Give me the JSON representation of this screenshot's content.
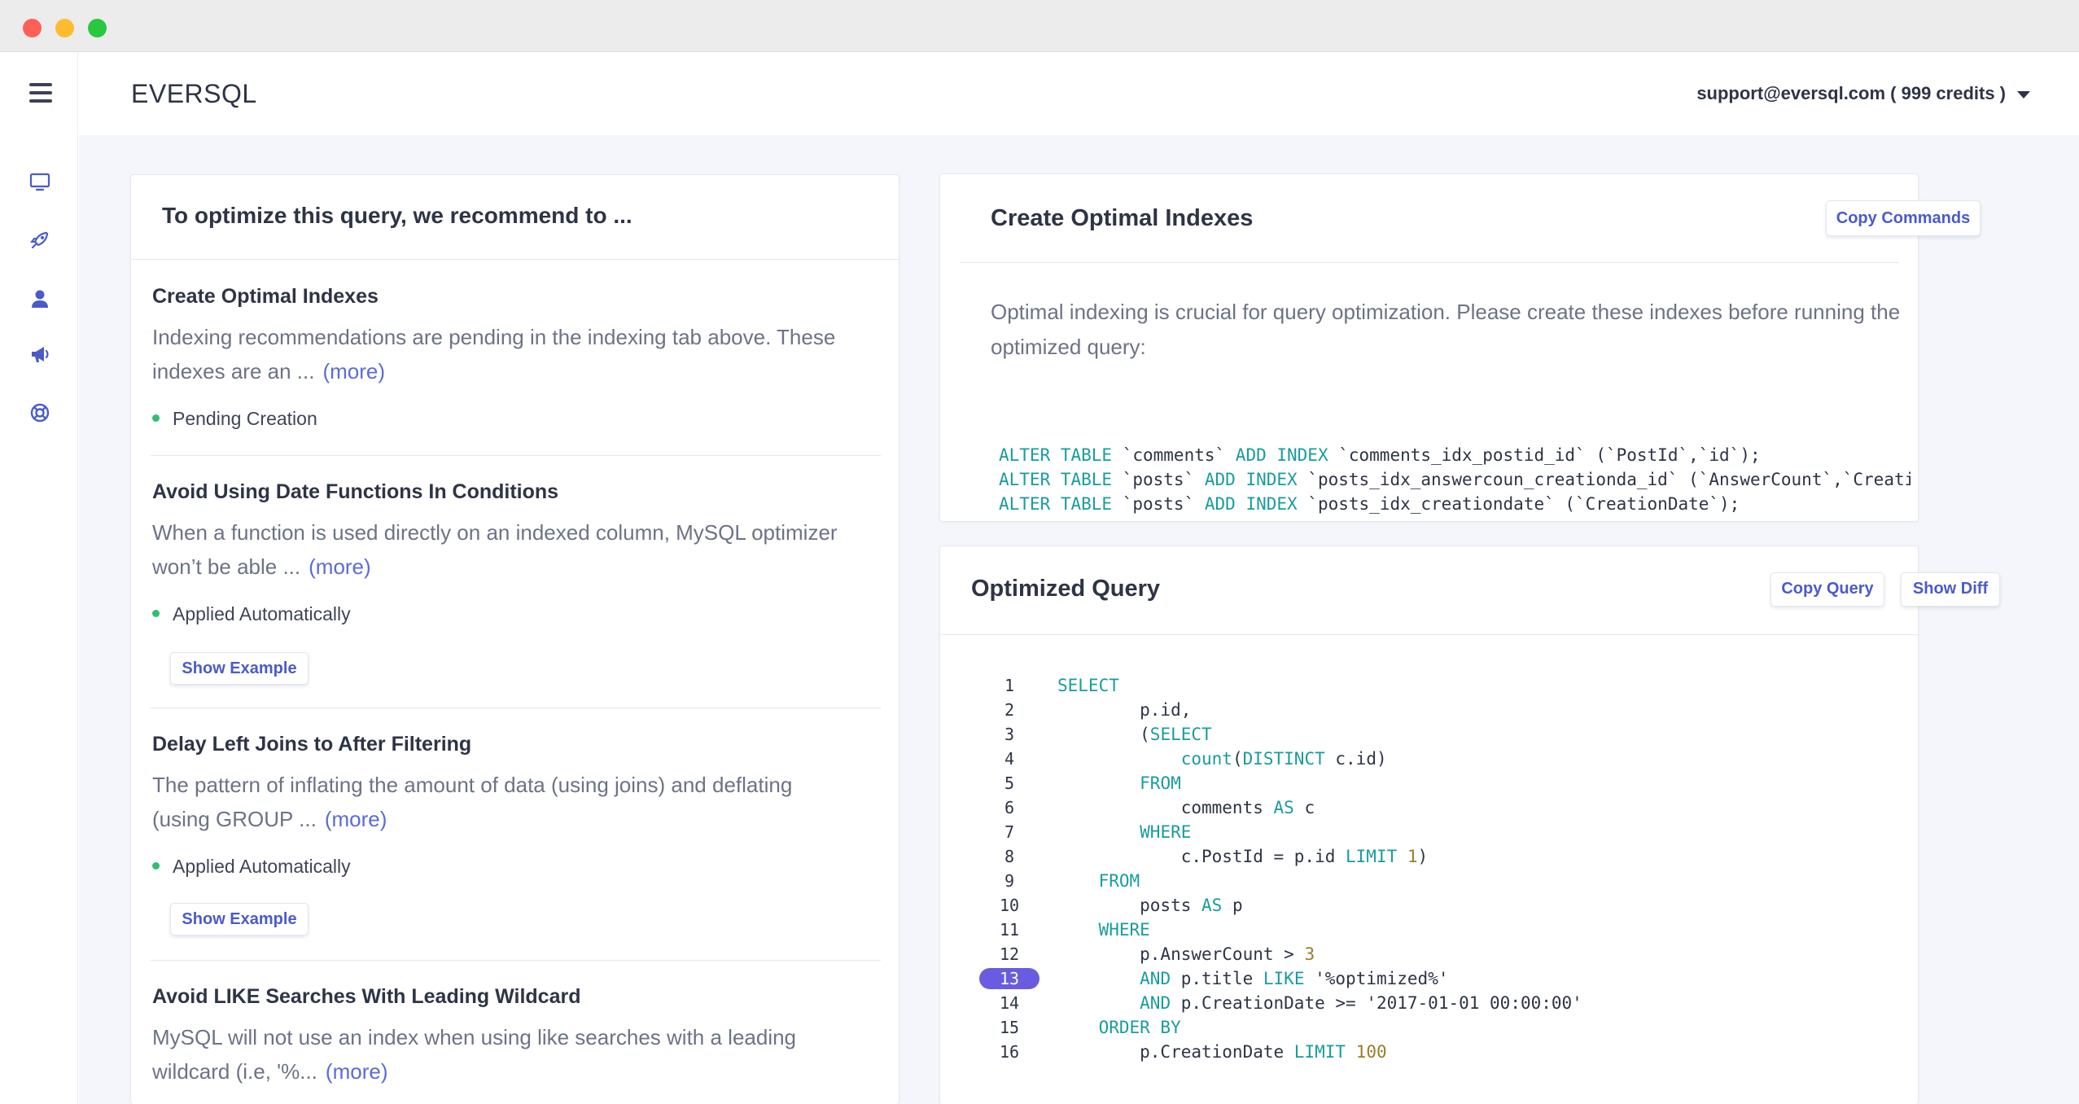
{
  "app": {
    "brand": "EVERSQL",
    "account": "support@eversql.com ( 999 credits )"
  },
  "sidebar": {
    "icons": [
      "monitor-icon",
      "rocket-icon",
      "user-icon",
      "megaphone-icon",
      "lifebuoy-icon"
    ]
  },
  "colors": {
    "accent": "#4a5bc9",
    "status_green": "#2fbf71",
    "keyword": "#1a9c9c",
    "highlight_line": "#6a5ce0"
  },
  "recommendations": {
    "header": "To optimize this query, we recommend to ...",
    "more_label": "(more)",
    "items": [
      {
        "title": "Create Optimal Indexes",
        "desc": [
          "Indexing recommendations are pending in the indexing tab above. These",
          "indexes are an ..."
        ],
        "status": "Pending Creation"
      },
      {
        "title": "Avoid Using Date Functions In Conditions",
        "desc": [
          "When a function is used directly on an indexed column, MySQL optimizer",
          "won’t be able ..."
        ],
        "status": "Applied Automatically",
        "button": "Show Example"
      },
      {
        "title": "Delay Left Joins to After Filtering",
        "desc": [
          "The pattern of inflating the amount of data (using joins) and deflating",
          "(using GROUP ..."
        ],
        "status": "Applied Automatically",
        "button": "Show Example"
      },
      {
        "title": "Avoid LIKE Searches With Leading Wildcard",
        "desc": [
          "MySQL will not use an index when using like searches with a leading",
          "wildcard (i.e, '%..."
        ]
      }
    ]
  },
  "indexes": {
    "title": "Create Optimal Indexes",
    "copy_button": "Copy Commands",
    "description": "Optimal indexing is crucial for query optimization. Please create these indexes before running the optimized query:",
    "commands": [
      "ALTER TABLE `comments` ADD INDEX `comments_idx_postid_id` (`PostId`,`id`);",
      "ALTER TABLE `posts` ADD INDEX `posts_idx_answercoun_creationda_id` (`AnswerCount`,`CreationDate`,",
      "ALTER TABLE `posts` ADD INDEX `posts_idx_creationdate` (`CreationDate`);"
    ]
  },
  "optimized_query": {
    "title": "Optimized Query",
    "copy_button": "Copy Query",
    "diff_button": "Show Diff",
    "highlighted_line": 13,
    "lines": [
      {
        "n": "1",
        "code": "SELECT"
      },
      {
        "n": "2",
        "code": "        p.id,"
      },
      {
        "n": "3",
        "code": "        (SELECT"
      },
      {
        "n": "4",
        "code": "            count(DISTINCT c.id)"
      },
      {
        "n": "5",
        "code": "        FROM"
      },
      {
        "n": "6",
        "code": "            comments AS c"
      },
      {
        "n": "7",
        "code": "        WHERE"
      },
      {
        "n": "8",
        "code": "            c.PostId = p.id LIMIT 1)"
      },
      {
        "n": "9",
        "code": "    FROM"
      },
      {
        "n": "10",
        "code": "        posts AS p"
      },
      {
        "n": "11",
        "code": "    WHERE"
      },
      {
        "n": "12",
        "code": "        p.AnswerCount > 3"
      },
      {
        "n": "13",
        "code": "        AND p.title LIKE '%optimized%'"
      },
      {
        "n": "14",
        "code": "        AND p.CreationDate >= '2017-01-01 00:00:00'"
      },
      {
        "n": "15",
        "code": "    ORDER BY"
      },
      {
        "n": "16",
        "code": "        p.CreationDate LIMIT 100"
      }
    ]
  }
}
